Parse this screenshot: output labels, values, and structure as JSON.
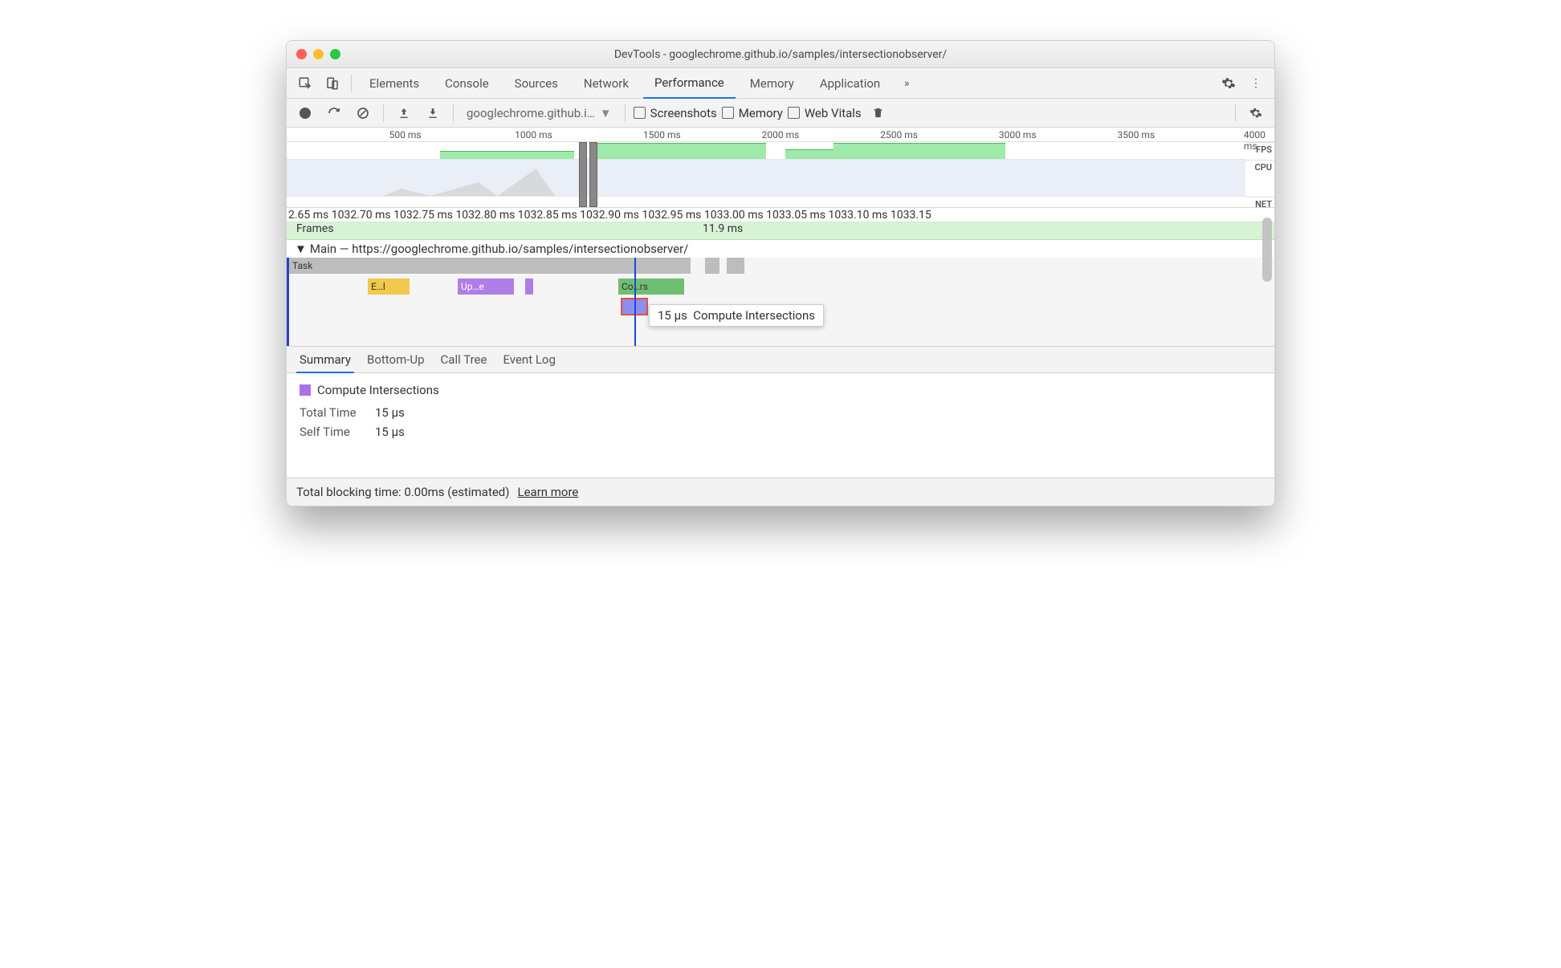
{
  "window": {
    "title": "DevTools - googlechrome.github.io/samples/intersectionobserver/"
  },
  "tabs": [
    "Elements",
    "Console",
    "Sources",
    "Network",
    "Performance",
    "Memory",
    "Application"
  ],
  "tabs_active": "Performance",
  "toolbar": {
    "profile_dropdown": "googlechrome.github.i…",
    "checkboxes": {
      "screenshots": "Screenshots",
      "memory": "Memory",
      "web_vitals": "Web Vitals"
    }
  },
  "overview": {
    "ticks": [
      "500 ms",
      "1000 ms",
      "1500 ms",
      "2000 ms",
      "2500 ms",
      "3000 ms",
      "3500 ms",
      "4000 ms"
    ],
    "tracks": [
      "FPS",
      "CPU",
      "NET"
    ]
  },
  "detail_ruler": "2.65 ms 1032.70 ms 1032.75 ms 1032.80 ms 1032.85 ms 1032.90 ms 1032.95 ms 1033.00 ms 1033.05 ms 1033.10 ms 1033.15",
  "frames": {
    "label": "Frames",
    "value": "11.9 ms"
  },
  "main": {
    "label": "Main — https://googlechrome.github.io/samples/intersectionobserver/"
  },
  "flame": {
    "task": "Task",
    "events": {
      "e": "E…l",
      "up": "Up…e",
      "co": "Co…rs"
    }
  },
  "tooltip": {
    "time": "15 µs",
    "name": "Compute Intersections"
  },
  "detail_tabs": [
    "Summary",
    "Bottom-Up",
    "Call Tree",
    "Event Log"
  ],
  "detail_tabs_active": "Summary",
  "summary": {
    "name": "Compute Intersections",
    "total_time_k": "Total Time",
    "total_time_v": "15 µs",
    "self_time_k": "Self Time",
    "self_time_v": "15 µs"
  },
  "footer": {
    "text": "Total blocking time: 0.00ms (estimated)",
    "link": "Learn more"
  }
}
